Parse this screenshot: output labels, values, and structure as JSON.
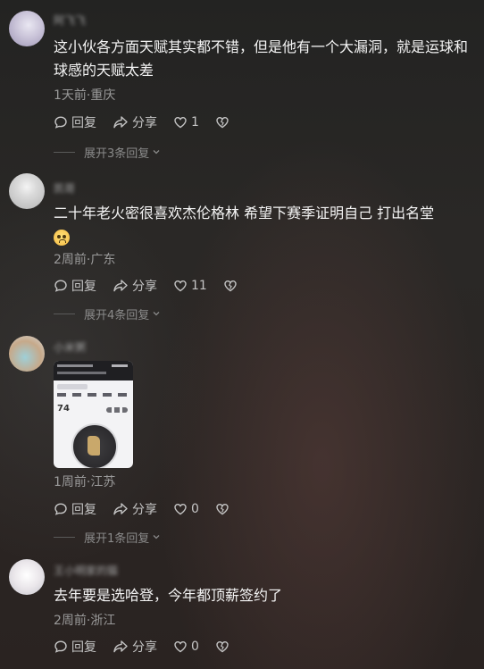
{
  "comments": [
    {
      "username": "阿飞飞",
      "text": "这小伙各方面天赋其实都不错，但是他有一个大漏洞，就是运球和球感的天赋太差",
      "meta": "1天前·重庆",
      "reply_label": "回复",
      "share_label": "分享",
      "like_count": "1",
      "expand_label": "展开3条回复"
    },
    {
      "username": "凯哥",
      "text": "二十年老火密很喜欢杰伦格林 希望下赛季证明自己 打出名堂",
      "emoji": "pleading-face-emoji",
      "meta": "2周前·广东",
      "reply_label": "回复",
      "share_label": "分享",
      "like_count": "11",
      "expand_label": "展开4条回复"
    },
    {
      "username": "小米粥",
      "image": "stats-screenshot",
      "meta": "1周前·江苏",
      "reply_label": "回复",
      "share_label": "分享",
      "like_count": "0",
      "expand_label": "展开1条回复"
    },
    {
      "username": "王小明家的猫",
      "text": "去年要是选哈登，今年都顶薪签约了",
      "meta": "2周前·浙江",
      "reply_label": "回复",
      "share_label": "分享",
      "like_count": "0"
    }
  ],
  "colors": {
    "text": "#f4f4f4",
    "meta": "#9a9a9a",
    "action": "#c4c4c4"
  }
}
